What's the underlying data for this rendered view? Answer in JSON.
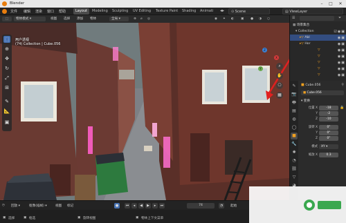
{
  "window": {
    "title": "Blender"
  },
  "menu": {
    "items": [
      "文件",
      "编辑",
      "渲染",
      "窗口",
      "帮助"
    ],
    "workspaces": [
      "Layout",
      "Modeling",
      "Sculpting",
      "UV Editing",
      "Texture Paint",
      "Shading",
      "Animati"
    ],
    "scene": "Scene",
    "view_layer": "ViewLayer"
  },
  "viewport_header": {
    "mode": "物体模式",
    "menus": [
      "视图",
      "选择",
      "添加",
      "物体"
    ],
    "orientation": "全局"
  },
  "viewport": {
    "view_name": "用户透视",
    "object_info": "(74) Collection | Cube.056"
  },
  "outliner": {
    "scene_collection": "场景集合",
    "collection": "Collection",
    "child1": "Abl",
    "child2": "Hor"
  },
  "properties": {
    "object_name": "Cube.056",
    "data_name": "Cube.056",
    "section": "变换",
    "location_label": "位置 X",
    "location": [
      "-18",
      "-2",
      "-10"
    ],
    "rotation_label": "旋转 X",
    "rotation": [
      "0°",
      "0°",
      "0°"
    ],
    "mode_label": "模式",
    "mode_value": "XY",
    "scale_label": "缩放 X",
    "scale_value": "0.3",
    "axis_y": "Y",
    "axis_z": "Z"
  },
  "timeline": {
    "playback": "回放",
    "keying": "抠像(插帧)",
    "view": "视图",
    "marker": "标记",
    "current_frame": "74",
    "start_label": "起始"
  },
  "status": {
    "select": "选择",
    "box_select": "框选",
    "rotate_view": "旋转视图",
    "object_menu": "物体上下文菜单"
  },
  "colors": {
    "accent": "#4772b3",
    "arrow": "#e02020",
    "blender_orange": "#e87d0d"
  }
}
